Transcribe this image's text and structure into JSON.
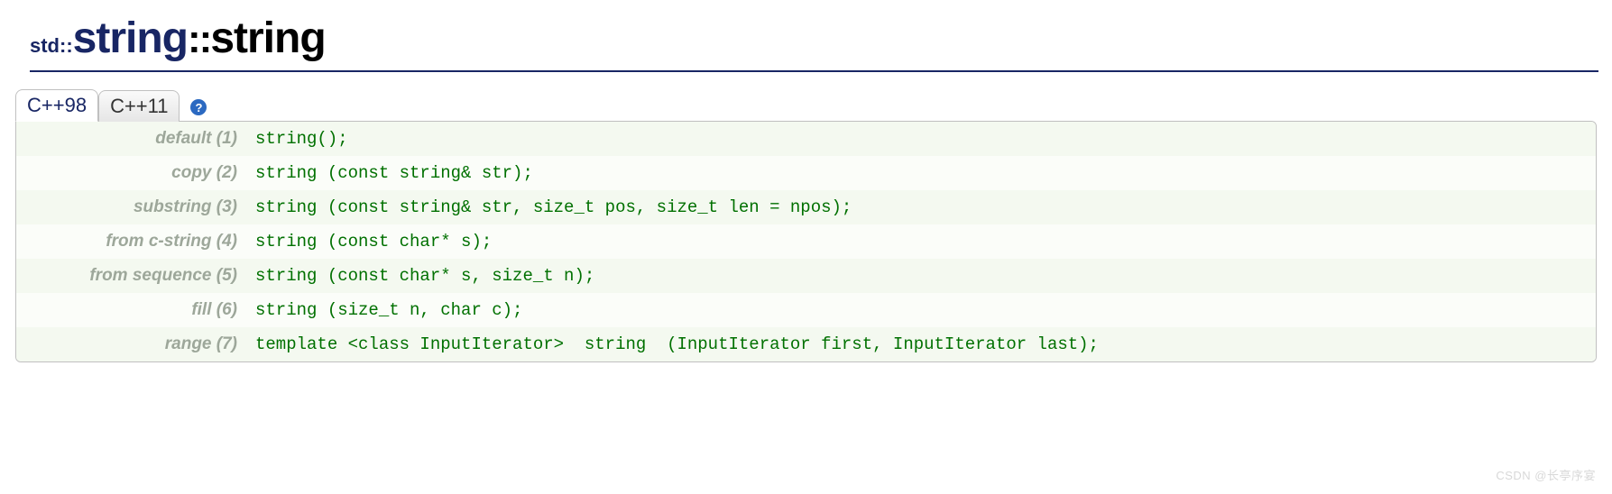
{
  "title": {
    "namespace": "std::",
    "class": "string",
    "separator": "::",
    "function": "string"
  },
  "tabs": [
    "C++98",
    "C++11"
  ],
  "active_tab": 0,
  "help_glyph": "?",
  "signatures": [
    {
      "label": "default (1)",
      "code": "string();"
    },
    {
      "label": "copy (2)",
      "code": "string (const string& str);"
    },
    {
      "label": "substring (3)",
      "code": "string (const string& str, size_t pos, size_t len = npos);"
    },
    {
      "label": "from c-string (4)",
      "code": "string (const char* s);"
    },
    {
      "label": "from sequence (5)",
      "code": "string (const char* s, size_t n);"
    },
    {
      "label": "fill (6)",
      "code": "string (size_t n, char c);"
    },
    {
      "label": "range (7)",
      "code": "template <class InputIterator>  string  (InputIterator first, InputIterator last);"
    }
  ],
  "watermark": "CSDN @长亭序宴"
}
